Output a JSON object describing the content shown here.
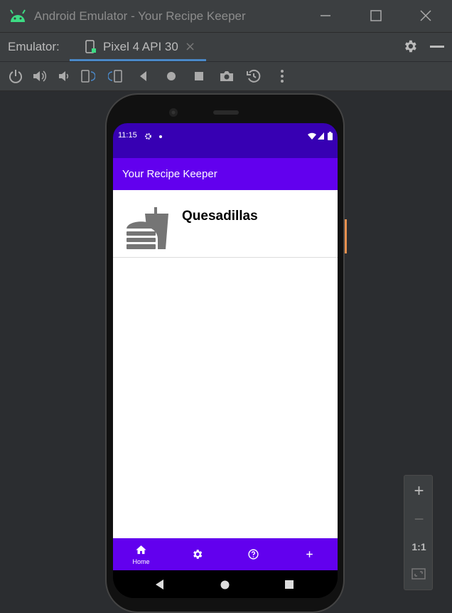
{
  "window": {
    "title": "Android Emulator - Your Recipe Keeper",
    "android_logo_icon": "android-head-icon",
    "minimize_icon": "minimize-icon",
    "maximize_icon": "maximize-icon",
    "close_icon": "close-icon"
  },
  "tabbar": {
    "label": "Emulator:",
    "device_tab": "Pixel 4 API 30",
    "device_tab_close": "×",
    "settings_icon": "gear-icon",
    "hide_icon": "minus-icon"
  },
  "toolbar": {
    "buttons": [
      "power-icon",
      "volume-up-icon",
      "volume-down-icon",
      "rotate-left-icon",
      "rotate-right-icon",
      "back-icon",
      "home-icon",
      "overview-icon",
      "screenshot-icon",
      "snapshot-icon",
      "more-icon"
    ]
  },
  "device": {
    "status": {
      "time": "11:15"
    },
    "app_title": "Your Recipe Keeper",
    "recipes": [
      {
        "name": "Quesadillas",
        "icon": "fastfood-icon"
      }
    ],
    "bottom_nav": [
      {
        "label": "Home",
        "icon": "home-icon"
      },
      {
        "label": "",
        "icon": "settings-icon"
      },
      {
        "label": "",
        "icon": "help-icon"
      },
      {
        "label": "",
        "icon": "add-icon"
      }
    ]
  },
  "zoom_panel": {
    "zoom_in": "+",
    "zoom_out": "−",
    "actual_size": "1:1"
  },
  "colors": {
    "status_bar": "#3700b3",
    "primary": "#6200ee",
    "android_green": "#3ddc84"
  }
}
